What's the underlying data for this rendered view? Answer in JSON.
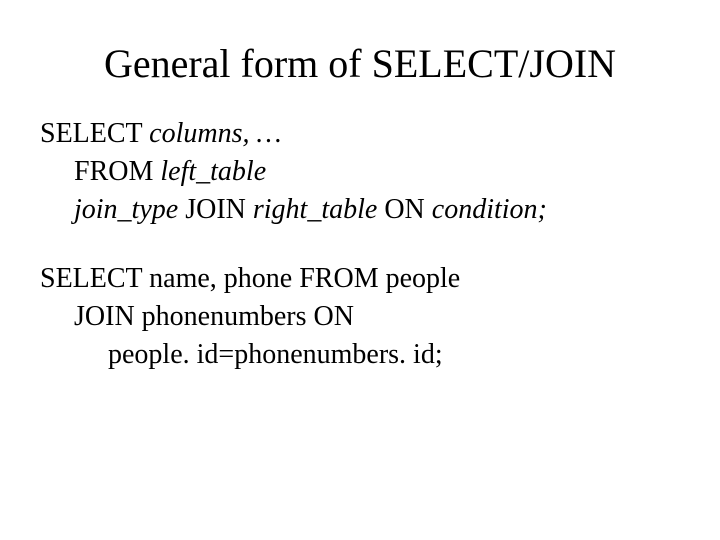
{
  "title": "General form of SELECT/JOIN",
  "syntax": {
    "line1_kw": "SELECT ",
    "line1_it": "columns, …",
    "line2_kw": "FROM ",
    "line2_it": "left_table",
    "line3_it_a": "join_type",
    "line3_kw_a": " JOIN ",
    "line3_it_b": "right_table",
    "line3_kw_b": " ON ",
    "line3_it_c": "condition;"
  },
  "example": {
    "line1": "SELECT name, phone FROM people",
    "line2": "JOIN phonenumbers ON",
    "line3": "people. id=phonenumbers. id;"
  }
}
